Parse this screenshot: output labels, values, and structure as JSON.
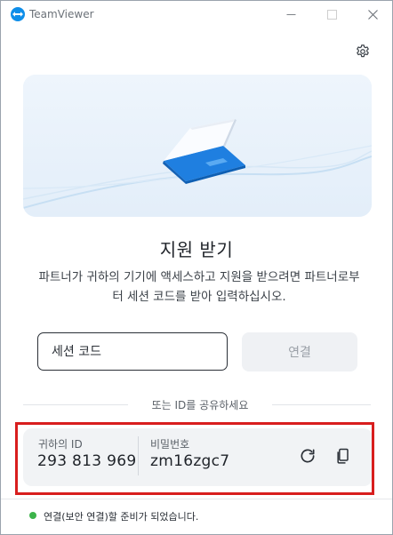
{
  "window": {
    "title": "TeamViewer"
  },
  "main": {
    "heading": "지원 받기",
    "description": "파트너가 귀하의 기기에 액세스하고 지원을 받으려면 파트너로부터 세션 코드를 받아 입력하십시오.",
    "session_placeholder": "세션 코드",
    "connect_label": "연결",
    "share_divider": "또는 ID를 공유하세요"
  },
  "id_card": {
    "id_label": "귀하의 ID",
    "id_value": "293 813 969",
    "password_label": "비밀번호",
    "password_value": "zm16zgc7"
  },
  "status": {
    "text": "연결(보안 연결)할 준비가 되었습니다.",
    "color": "#3cb34a"
  },
  "colors": {
    "brand": "#0e8ee9",
    "highlight": "#d81e1e"
  },
  "icons": {
    "settings": "gear-icon",
    "refresh": "refresh-icon",
    "copy": "copy-icon"
  }
}
